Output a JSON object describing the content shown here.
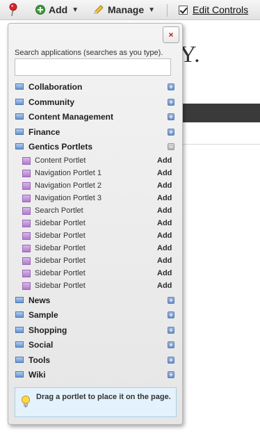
{
  "dockbar": {
    "add_label": "Add",
    "manage_label": "Manage",
    "edit_controls_label": "Edit Controls"
  },
  "panel": {
    "close_label": "×",
    "search_label": "Search applications (searches as you type).",
    "search_value": "",
    "categories": [
      {
        "label": "Collaboration",
        "expanded": false
      },
      {
        "label": "Community",
        "expanded": false
      },
      {
        "label": "Content Management",
        "expanded": false
      },
      {
        "label": "Finance",
        "expanded": false
      },
      {
        "label": "Gentics Portlets",
        "expanded": true
      },
      {
        "label": "News",
        "expanded": false
      },
      {
        "label": "Sample",
        "expanded": false
      },
      {
        "label": "Shopping",
        "expanded": false
      },
      {
        "label": "Social",
        "expanded": false
      },
      {
        "label": "Tools",
        "expanded": false
      },
      {
        "label": "Wiki",
        "expanded": false
      }
    ],
    "portlets": [
      {
        "label": "Content Portlet",
        "action": "Add"
      },
      {
        "label": "Navigation Portlet 1",
        "action": "Add"
      },
      {
        "label": "Navigation Portlet 2",
        "action": "Add"
      },
      {
        "label": "Navigation Portlet 3",
        "action": "Add"
      },
      {
        "label": "Search Portlet",
        "action": "Add"
      },
      {
        "label": "Sidebar Portlet",
        "action": "Add"
      },
      {
        "label": "Sidebar Portlet",
        "action": "Add"
      },
      {
        "label": "Sidebar Portlet",
        "action": "Add"
      },
      {
        "label": "Sidebar Portlet",
        "action": "Add"
      },
      {
        "label": "Sidebar Portlet",
        "action": "Add"
      },
      {
        "label": "Sidebar Portlet",
        "action": "Add"
      }
    ],
    "hint": "Drag a portlet to place it on the page."
  },
  "background": {
    "partial_heading": "Y."
  },
  "colors": {
    "close_x": "#c0151f",
    "category_icon": "#6a93cf",
    "portlet_icon": "#b07ccc",
    "hint_bg": "#e3f2fc",
    "background_navbar": "#3a3a3a"
  }
}
